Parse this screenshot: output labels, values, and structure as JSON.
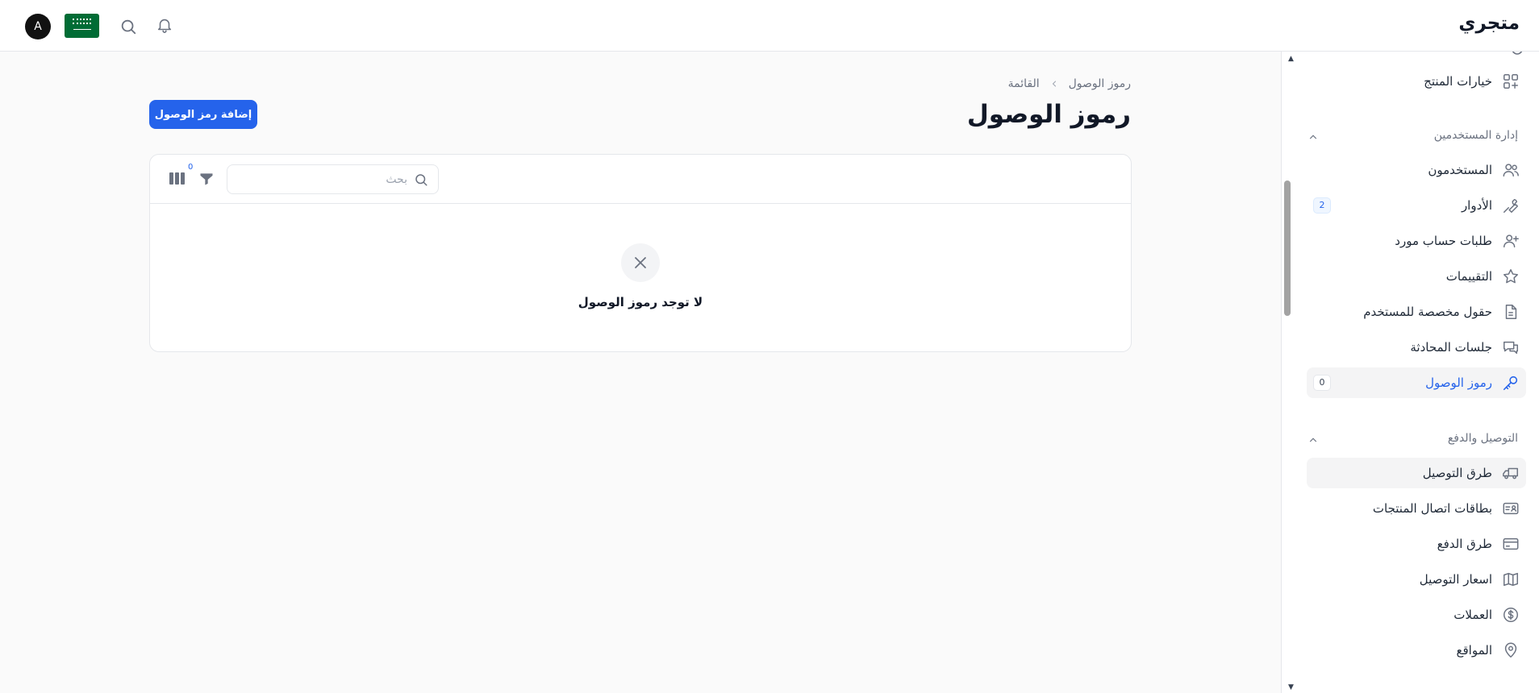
{
  "header": {
    "brand": "متجري",
    "avatar_initial": "A",
    "flag_alt": "Saudi Arabia"
  },
  "sidebar": {
    "items_top": [
      {
        "label": "خيارات المنتج",
        "icon": "squares-plus-icon"
      }
    ],
    "groups": [
      {
        "title": "إدارة المستخدمين",
        "items": [
          {
            "label": "المستخدمون",
            "icon": "users-icon"
          },
          {
            "label": "الأدوار",
            "icon": "key-icon",
            "badge": "2"
          },
          {
            "label": "طلبات حساب مورد",
            "icon": "user-plus-icon"
          },
          {
            "label": "التقييمات",
            "icon": "star-icon"
          },
          {
            "label": "حقول مخصصة للمستخدم",
            "icon": "document-icon"
          },
          {
            "label": "جلسات المحادثة",
            "icon": "chat-icon"
          },
          {
            "label": "رموز الوصول",
            "icon": "key-icon",
            "badge": "0",
            "active": true
          }
        ]
      },
      {
        "title": "التوصيل والدفع",
        "items": [
          {
            "label": "طرق التوصيل",
            "icon": "truck-icon"
          },
          {
            "label": "بطاقات اتصال المنتجات",
            "icon": "id-card-icon"
          },
          {
            "label": "طرق الدفع",
            "icon": "credit-card-icon"
          },
          {
            "label": "اسعار التوصيل",
            "icon": "map-icon"
          },
          {
            "label": "العملات",
            "icon": "currency-dollar-icon"
          },
          {
            "label": "المواقع",
            "icon": "map-pin-icon"
          }
        ]
      }
    ]
  },
  "breadcrumb": {
    "items": [
      "رموز الوصول",
      "القائمة"
    ]
  },
  "page": {
    "title": "رموز الوصول",
    "add_button": "إضافة رمز الوصول"
  },
  "table": {
    "search_placeholder": "بحث",
    "filter_count": "0",
    "empty_message": "لا توجد رموز الوصول"
  },
  "colors": {
    "accent": "#2563eb",
    "flag_green": "#006c35"
  }
}
